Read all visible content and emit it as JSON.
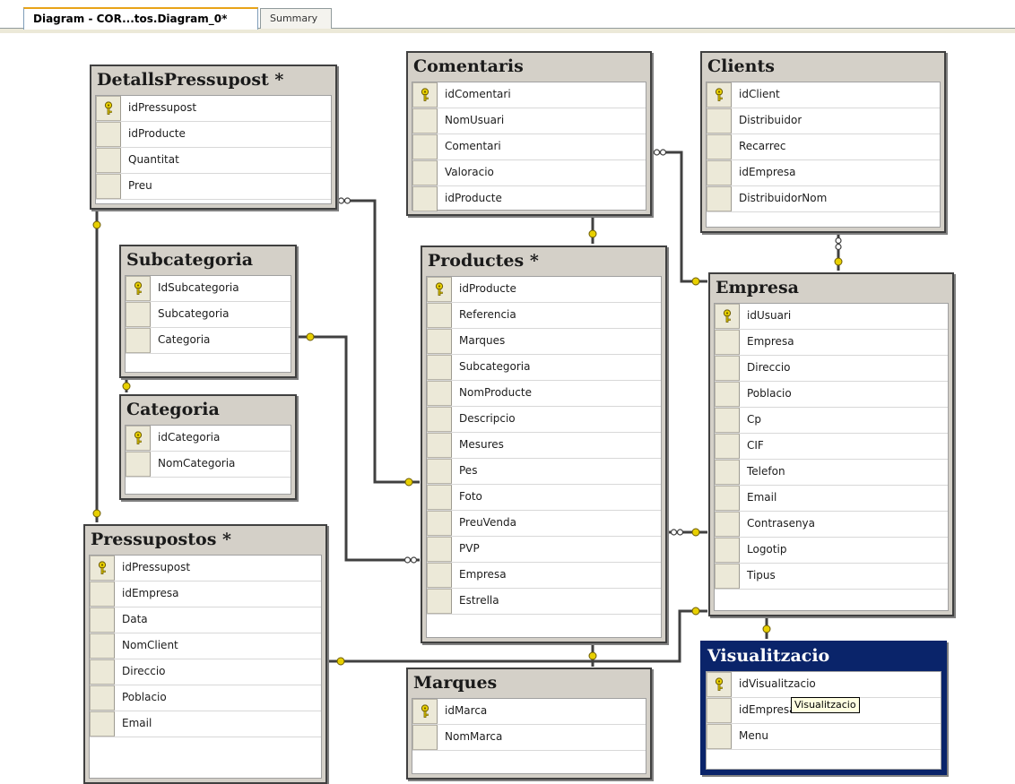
{
  "tabs": {
    "active": "Diagram - COR...tos.Diagram_0*",
    "inactive": "Summary"
  },
  "tables": {
    "detallspressupost": {
      "title": "DetallsPressupost *",
      "columns": [
        "idPressupost",
        "idProducte",
        "Quantitat",
        "Preu"
      ]
    },
    "comentaris": {
      "title": "Comentaris",
      "columns": [
        "idComentari",
        "NomUsuari",
        "Comentari",
        "Valoracio",
        "idProducte"
      ]
    },
    "clients": {
      "title": "Clients",
      "columns": [
        "idClient",
        "Distribuidor",
        "Recarrec",
        "idEmpresa",
        "DistribuidorNom"
      ]
    },
    "subcategoria": {
      "title": "Subcategoria",
      "columns": [
        "IdSubcategoria",
        "Subcategoria",
        "Categoria"
      ]
    },
    "categoria": {
      "title": "Categoria",
      "columns": [
        "idCategoria",
        "NomCategoria"
      ]
    },
    "productes": {
      "title": "Productes *",
      "columns": [
        "idProducte",
        "Referencia",
        "Marques",
        "Subcategoria",
        "NomProducte",
        "Descripcio",
        "Mesures",
        "Pes",
        "Foto",
        "PreuVenda",
        "PVP",
        "Empresa",
        "Estrella"
      ]
    },
    "empresa": {
      "title": "Empresa",
      "columns": [
        "idUsuari",
        "Empresa",
        "Direccio",
        "Poblacio",
        "Cp",
        "CIF",
        "Telefon",
        "Email",
        "Contrasenya",
        "Logotip",
        "Tipus"
      ]
    },
    "pressupostos": {
      "title": "Pressupostos *",
      "columns": [
        "idPressupost",
        "idEmpresa",
        "Data",
        "NomClient",
        "Direccio",
        "Poblacio",
        "Email"
      ]
    },
    "marques": {
      "title": "Marques",
      "columns": [
        "idMarca",
        "NomMarca"
      ]
    },
    "visualitzacio": {
      "title": "Visualitzacio",
      "columns": [
        "idVisualitzacio",
        "idEmpresa",
        "Menu"
      ]
    }
  },
  "tooltip": {
    "text": "Visualitzacio"
  },
  "colors": {
    "line": "#404040",
    "key": "#e8d000",
    "selected_title": "#0a246a",
    "table_body": "#d4d0c8"
  }
}
